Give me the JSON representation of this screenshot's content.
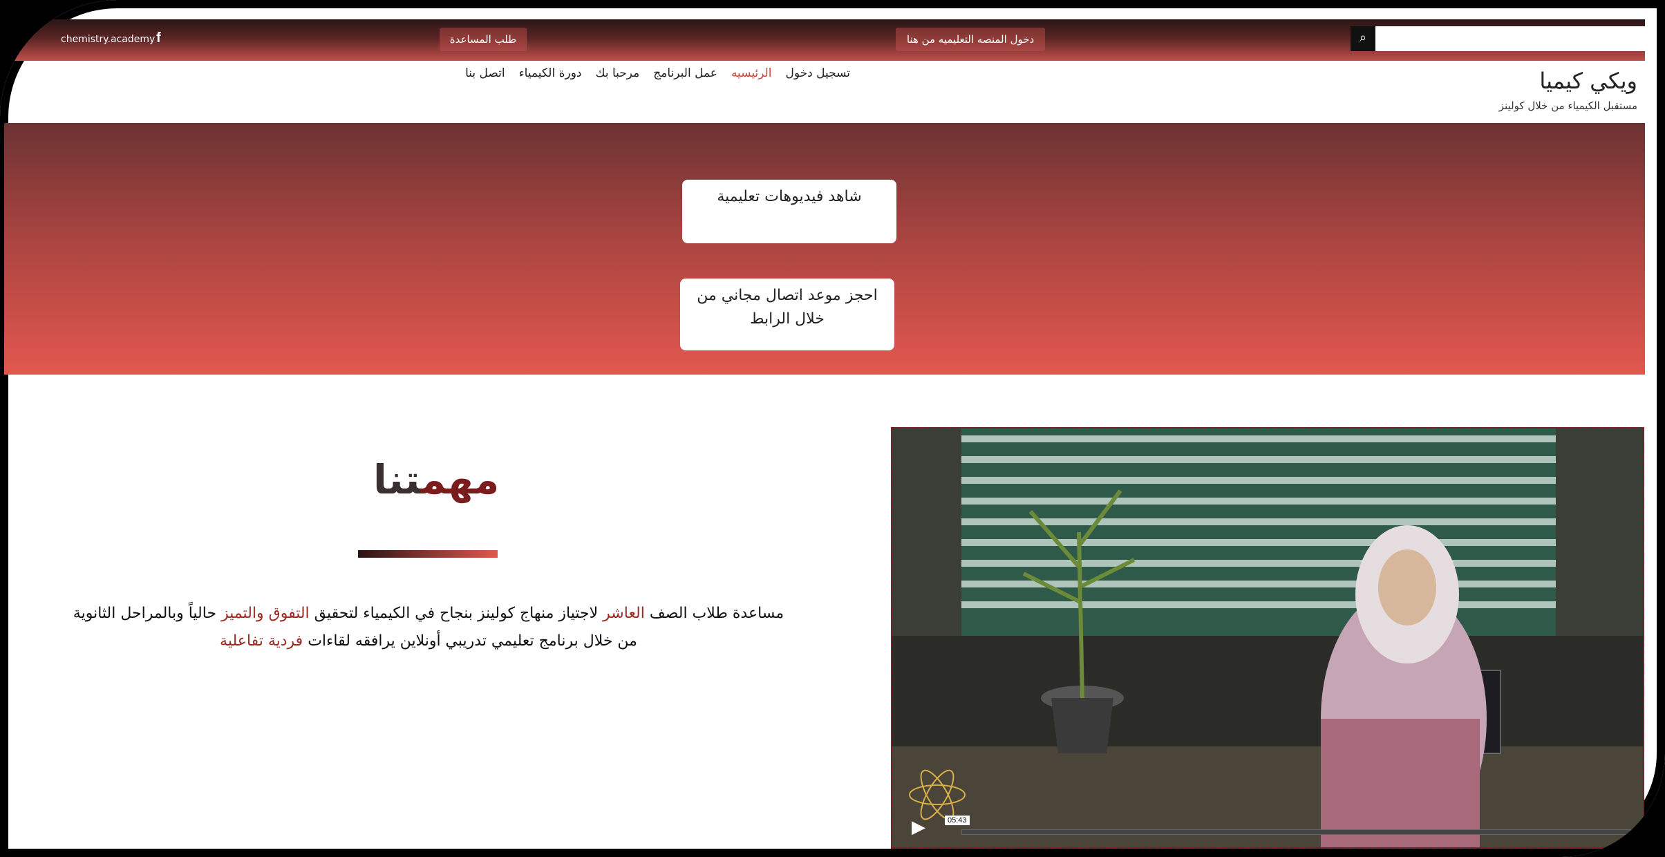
{
  "topbar": {
    "site_link": "chemistry.academy",
    "facebook_icon": "facebook-icon",
    "help_button": "طلب المساعدة",
    "platform_button": "دخول المنصه التعليميه من هنا",
    "search_placeholder": "",
    "search_icon": "search-icon"
  },
  "header": {
    "brand_title": "ويكي كيميا",
    "brand_subtitle": "مستقبل الكيمياء من خلال كولينز",
    "nav": [
      {
        "label": "تسجيل دخول",
        "active": false
      },
      {
        "label": "الرئيسيه",
        "active": true
      },
      {
        "label": "عمل البرنامج",
        "active": false
      },
      {
        "label": "مرحبا بك",
        "active": false
      },
      {
        "label": "دورة الكيمياء",
        "active": false
      },
      {
        "label": "اتصل بنا",
        "active": false
      }
    ]
  },
  "hero": {
    "videos_button": "شاهد فيديوهات تعليمية",
    "booking_button": "احجز موعد اتصال مجاني من خلال الرابط"
  },
  "mission": {
    "title_part1": "مهم",
    "title_part2": "تنا",
    "line1_a": "مساعدة طلاب الصف ",
    "line1_b": "العاشر",
    "line1_c": "  لاجتياز منهاج كولينز بنجاح في الكيمياء  لتحقيق ",
    "line1_d": "التفوق والتميز",
    "line1_e": " حالياً وبالمراحل الثانوية",
    "line2_a": "من خلال برنامج تعليمي تدريبي أونلاين  يرافقه لقاءات ",
    "line2_b": "فردية تفاعلية"
  },
  "video": {
    "time": "05:43",
    "play_icon": "play-icon"
  },
  "colors": {
    "accent": "#d0453d",
    "hero_top": "#6c3232",
    "hero_bottom": "#e2574e"
  }
}
